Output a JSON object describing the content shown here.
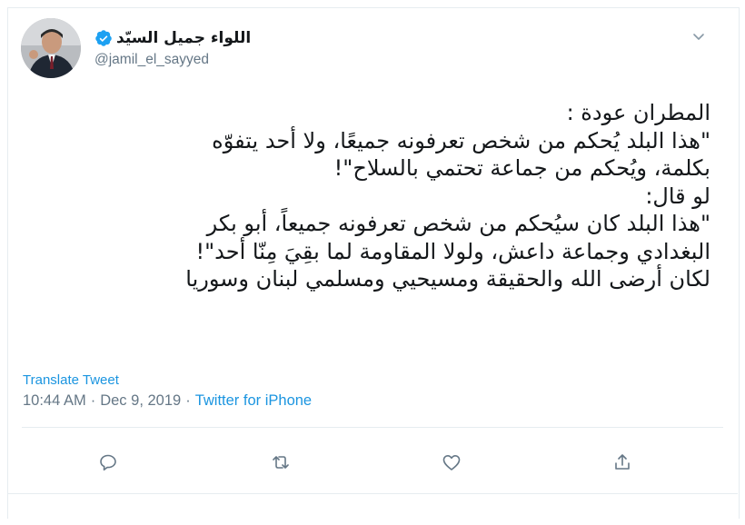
{
  "tweet": {
    "display_name": "اللواء جميل السيّد",
    "handle": "@jamil_el_sayyed",
    "text_lines": [
      "المطران عودة :",
      "\"هذا البلد يُحكم من شخص تعرفونه جميعًا، ولا أحد يتفوّه",
      "بكلمة، ويُحكم من جماعة تحتمي بالسلاح\"!",
      "لو قال:",
      "\"هذا البلد كان سيُحكم من شخص تعرفونه جميعاً، أبو بكر",
      "البغدادي وجماعة داعش، ولولا المقاومة لما بقِيَ مِنّا أحد\"!",
      "لكان أرضى الله والحقيقة ومسيحيي ومسلمي لبنان وسوريا"
    ],
    "translate_label": "Translate Tweet",
    "time": "10:44 AM",
    "separator": "·",
    "date": "Dec 9, 2019",
    "source": "Twitter for iPhone"
  },
  "icons": {
    "verified": "verified-badge-icon",
    "menu": "chevron-down-icon",
    "reply": "reply-icon",
    "retweet": "retweet-icon",
    "like": "heart-icon",
    "share": "share-icon"
  },
  "colors": {
    "link": "#1b95e0",
    "text": "#14171a",
    "muted": "#657786",
    "border": "#e6ecf0"
  }
}
